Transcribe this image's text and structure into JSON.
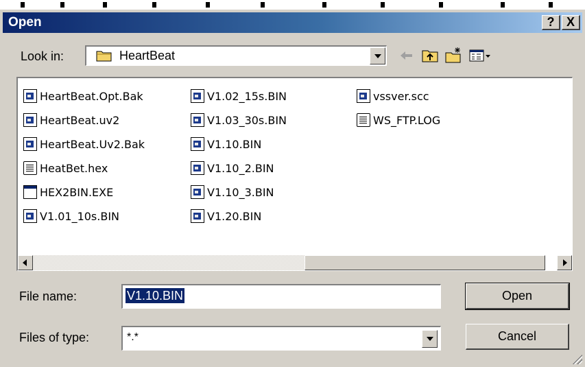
{
  "window": {
    "title": "Open",
    "help_button": "?",
    "close_button": "X"
  },
  "look_in": {
    "label": "Look in:",
    "value": "HeartBeat"
  },
  "toolbar": {
    "back_icon": "back-arrow-icon",
    "up_icon": "up-folder-icon",
    "new_folder_icon": "new-folder-icon",
    "view_menu_icon": "view-menu-icon"
  },
  "files": {
    "col1": [
      {
        "name": "HeartBeat.Opt.Bak",
        "icon": "bin-file-icon"
      },
      {
        "name": "HeartBeat.uv2",
        "icon": "bin-file-icon"
      },
      {
        "name": "HeartBeat.Uv2.Bak",
        "icon": "bin-file-icon"
      },
      {
        "name": "HeatBet.hex",
        "icon": "text-file-icon"
      },
      {
        "name": "HEX2BIN.EXE",
        "icon": "exe-file-icon"
      },
      {
        "name": "V1.01_10s.BIN",
        "icon": "bin-file-icon"
      }
    ],
    "col2": [
      {
        "name": "V1.02_15s.BIN",
        "icon": "bin-file-icon"
      },
      {
        "name": "V1.03_30s.BIN",
        "icon": "bin-file-icon"
      },
      {
        "name": "V1.10.BIN",
        "icon": "bin-file-icon"
      },
      {
        "name": "V1.10_2.BIN",
        "icon": "bin-file-icon"
      },
      {
        "name": "V1.10_3.BIN",
        "icon": "bin-file-icon"
      },
      {
        "name": "V1.20.BIN",
        "icon": "bin-file-icon"
      }
    ],
    "col3": [
      {
        "name": "vssver.scc",
        "icon": "bin-file-icon"
      },
      {
        "name": "WS_FTP.LOG",
        "icon": "text-file-icon"
      }
    ]
  },
  "file_name": {
    "label": "File name:",
    "value": "V1.10.BIN"
  },
  "file_type": {
    "label": "Files of type:",
    "value": "*.*"
  },
  "buttons": {
    "open": "Open",
    "cancel": "Cancel"
  }
}
